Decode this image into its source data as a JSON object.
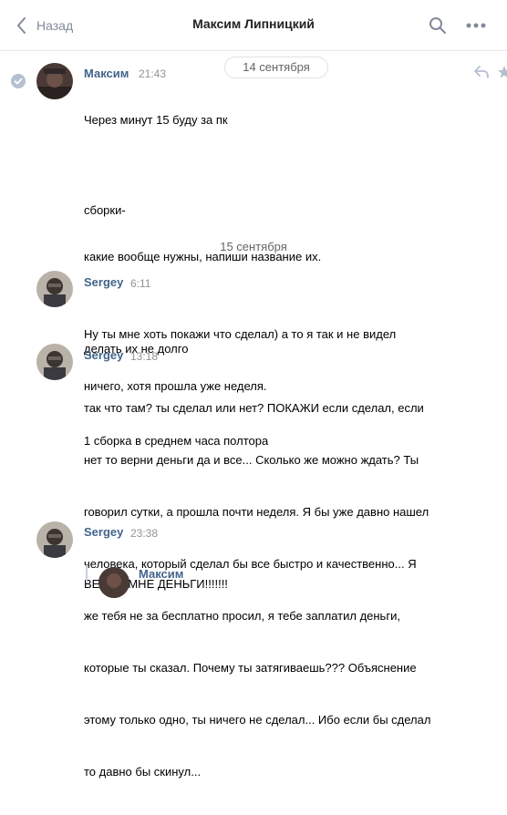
{
  "header": {
    "back_label": "Назад",
    "title": "Максим Липницкий"
  },
  "dates": {
    "first": "14 сентября",
    "second": "15 сентября"
  },
  "messages": [
    {
      "author": "Максим",
      "time": "21:43",
      "lines": [
        "Через минут 15 буду за пк",
        "",
        "сборки-",
        "какие вообще нужны, напиши название их.",
        "",
        "делать их не долго",
        "",
        "1 сборка в среднем часа полтора"
      ]
    },
    {
      "author": "Sergey",
      "time": "6:11",
      "lines": [
        "Ну ты мне хоть покажи что сделал) а то я так и не видел",
        "ничего, хотя прошла уже неделя."
      ]
    },
    {
      "author": "Sergey",
      "time": "13:18",
      "lines": [
        "так что там? ты сделал или нет? ПОКАЖИ если сделал, если",
        "нет то верни деньги да и все... Сколько же можно ждать? Ты",
        "говорил сутки, а прошла почти неделя. Я бы уже давно нашел",
        "человека, который сделал бы все быстро и качественно... Я",
        "же тебя не за бесплатно просил, я тебе заплатил деньги,",
        "которые ты сказал. Почему ты затягиваешь??? Объяснение",
        "этому только одно, ты ничего не сделал... Ибо если бы сделал",
        "то давно бы скинул..."
      ]
    },
    {
      "author": "Sergey",
      "time": "23:38",
      "lines": [
        "ВЕРНИ МНЕ ДЕНЬГИ!!!!!!!"
      ]
    }
  ],
  "quote": {
    "author": "Максим"
  },
  "colors": {
    "link": "#42648b",
    "meta": "#939393",
    "header_icons": "#828a99",
    "border": "#e7e8ec"
  },
  "icons": {
    "back": "chevron-left-icon",
    "search": "search-icon",
    "more": "more-dots-icon",
    "read": "check-icon",
    "reply": "reply-icon",
    "favorite": "star-icon"
  }
}
